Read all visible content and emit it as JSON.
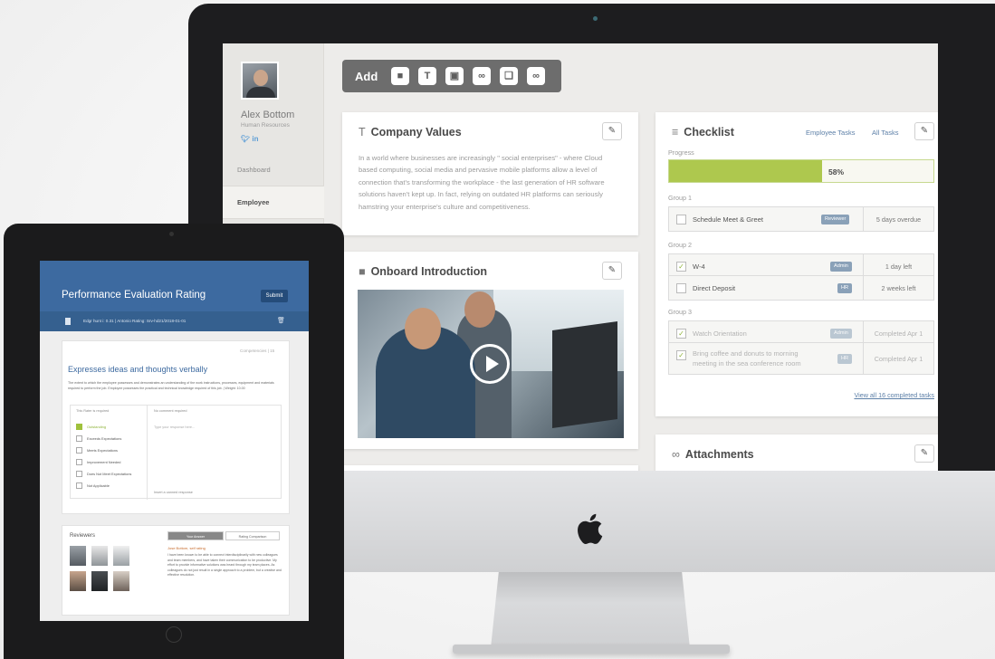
{
  "imac": {
    "profile": {
      "name": "Alex Bottom",
      "department": "Human Resources",
      "social": "in"
    },
    "nav": [
      "Dashboard",
      "Employee"
    ],
    "toolbar": {
      "add_label": "Add",
      "buttons": [
        "video-icon",
        "text-icon",
        "image-icon",
        "link-icon",
        "file-icon",
        "attach-icon"
      ]
    },
    "company_values": {
      "title": "Company Values",
      "text": "In a world where businesses are increasingly \" social enterprises\" - where Cloud based computing, social media and pervasive mobile platforms allow a level of connection that's transforming the workplace - the last generation of HR software solutions haven't kept up. In fact, relying on outdated HR platforms can seriously hamstring your enterprise's culture and competitiveness."
    },
    "onboard": {
      "title": "Onboard Introduction"
    },
    "checklist": {
      "title": "Checklist",
      "link_employee_tasks": "Employee Tasks",
      "link_all_tasks": "All Tasks",
      "progress_label": "Progress",
      "progress_value": 0.58,
      "progress_text": "58%",
      "groups": [
        {
          "name": "Group 1",
          "tasks": [
            {
              "name": "Schedule Meet & Greet",
              "badge": "Reviewer",
              "due": "5 days overdue",
              "checked": false,
              "done": false
            }
          ]
        },
        {
          "name": "Group 2",
          "tasks": [
            {
              "name": "W-4",
              "badge": "Admin",
              "due": "1 day left",
              "checked": true,
              "done": false
            },
            {
              "name": "Direct Deposit",
              "badge": "HR",
              "due": "2 weeks left",
              "checked": false,
              "done": false
            }
          ]
        },
        {
          "name": "Group 3",
          "tasks": [
            {
              "name": "Watch Orientation",
              "badge": "Admin",
              "due": "Completed Apr 1",
              "checked": true,
              "done": true
            },
            {
              "name": "Bring coffee and donuts to morning meeting in the sea conference room",
              "badge": "HR",
              "due": "Completed Apr 1",
              "checked": true,
              "done": true
            }
          ]
        }
      ],
      "view_all": "View all 16 completed tasks"
    },
    "attachments": {
      "title": "Attachments"
    }
  },
  "tablet": {
    "title": "Performance Evaluation Rating",
    "submit": "Submit",
    "subheader": "Edgr hunt i: 0.31  |  Antonio Rating: Srv-hd21/2018-01-01",
    "competency": "Competencies | 15",
    "question": "Expresses ideas and thoughts verbally",
    "description": "The extent to which the employee possesses and demonstrates an understanding of the work instructions, processes, equipment and materials required to perform the job. Employee possesses the practical and technical knowledge required of this job. | Weight: 10.00",
    "col_rating": "This Rater is required",
    "col_comment": "No comment required",
    "options": [
      "Outstanding",
      "Exceeds Expectations",
      "Meets Expectations",
      "Improvement Needed",
      "Does Not Meet Expectations",
      "Not Applicable"
    ],
    "selected_option": 0,
    "comment_placeholder": "Type your response here...",
    "insert_text": "Insert a canned response",
    "reviewers_label": "Reviewers",
    "tab_your_answer": "Your Answer",
    "tab_rating_comparison": "Rating Comparison",
    "reviewer_name": "Jose Bottom, self rating",
    "reviewer_text": "I have been known to be able to connect interdisciplinarily with new colleagues and team members, and have taken their communication to be productive. My effort to provide informative solutions was heard through my team places. As colleagues do not just result in a single approach to a problem, but a creative and effective resolution."
  },
  "colors": {
    "accent_blue": "#3d6aa0",
    "progress_green": "#aec84e",
    "badge_blue": "#8aa1b8"
  }
}
